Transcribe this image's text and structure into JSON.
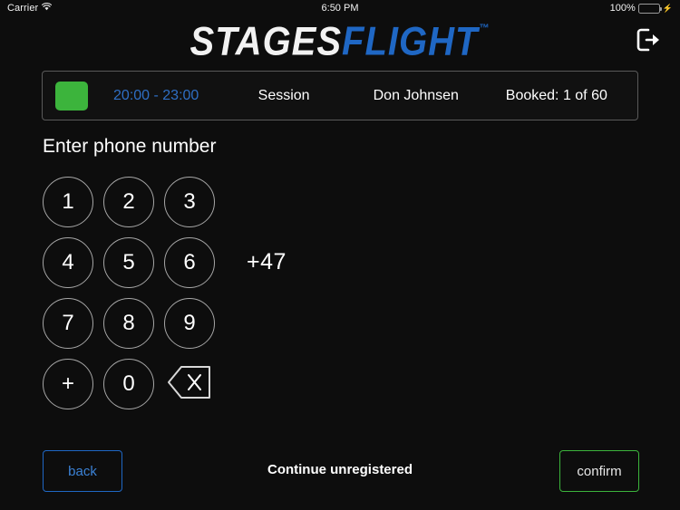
{
  "status_bar": {
    "carrier": "Carrier",
    "wifi_icon": "wifi-icon",
    "time": "6:50 PM",
    "battery_percent": "100%",
    "battery_icon": "battery-full-icon",
    "charging_icon": "⚡"
  },
  "header": {
    "logo_part1": "STAGES",
    "logo_part2": "FLIGHT",
    "logo_trademark": "™",
    "logout_icon": "logout-icon"
  },
  "session": {
    "color_swatch": "#3cb43c",
    "time_range": "20:00 - 23:00",
    "type": "Session",
    "host": "Don Johnsen",
    "booked": "Booked: 1 of 60"
  },
  "main": {
    "prompt": "Enter phone number",
    "country_code": "+47"
  },
  "keypad": {
    "keys": [
      {
        "label": "1",
        "name": "key-1"
      },
      {
        "label": "2",
        "name": "key-2"
      },
      {
        "label": "3",
        "name": "key-3"
      },
      {
        "label": "4",
        "name": "key-4"
      },
      {
        "label": "5",
        "name": "key-5"
      },
      {
        "label": "6",
        "name": "key-6"
      },
      {
        "label": "7",
        "name": "key-7"
      },
      {
        "label": "8",
        "name": "key-8"
      },
      {
        "label": "9",
        "name": "key-9"
      },
      {
        "label": "+",
        "name": "key-plus"
      },
      {
        "label": "0",
        "name": "key-0"
      },
      {
        "label": "",
        "name": "key-backspace"
      }
    ]
  },
  "footer": {
    "back_label": "back",
    "continue_unregistered_label": "Continue unregistered",
    "confirm_label": "confirm"
  },
  "colors": {
    "accent_blue": "#1f67c4",
    "accent_green": "#3cb43c",
    "background": "#0d0d0d"
  }
}
